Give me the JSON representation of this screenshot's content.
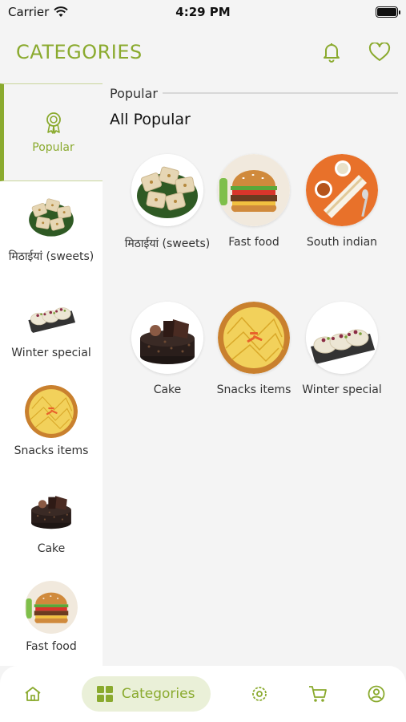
{
  "status_bar": {
    "carrier": "Carrier",
    "time": "4:29 PM"
  },
  "header": {
    "title": "CATEGORIES",
    "bell_icon": "bell-icon",
    "heart_icon": "heart-icon"
  },
  "colors": {
    "accent": "#8aaa2e",
    "nav_active_bg": "#eaf0d8"
  },
  "sidebar": {
    "items": [
      {
        "label": "Popular",
        "icon": "badge-icon",
        "active": true
      },
      {
        "label": "मिठाईयां (sweets)",
        "thumb": "sweets"
      },
      {
        "label": "Winter special",
        "thumb": "winter"
      },
      {
        "label": "Snacks items",
        "thumb": "snacks"
      },
      {
        "label": "Cake",
        "thumb": "cake"
      },
      {
        "label": "Fast food",
        "thumb": "burger"
      }
    ]
  },
  "main": {
    "section_label": "Popular",
    "section_title": "All Popular",
    "categories": [
      {
        "label": "मिठाईयां (sweets)",
        "thumb": "sweets"
      },
      {
        "label": "Fast food",
        "thumb": "burger"
      },
      {
        "label": "South indian",
        "thumb": "dosa"
      },
      {
        "label": "Cake",
        "thumb": "cake"
      },
      {
        "label": "Snacks items",
        "thumb": "snacks"
      },
      {
        "label": "Winter special",
        "thumb": "winter"
      }
    ]
  },
  "bottom_nav": {
    "home_icon": "home-icon",
    "categories_label": "Categories",
    "categories_icon": "grid-icon",
    "offers_icon": "settings-icon",
    "cart_icon": "cart-icon",
    "profile_icon": "profile-icon"
  }
}
